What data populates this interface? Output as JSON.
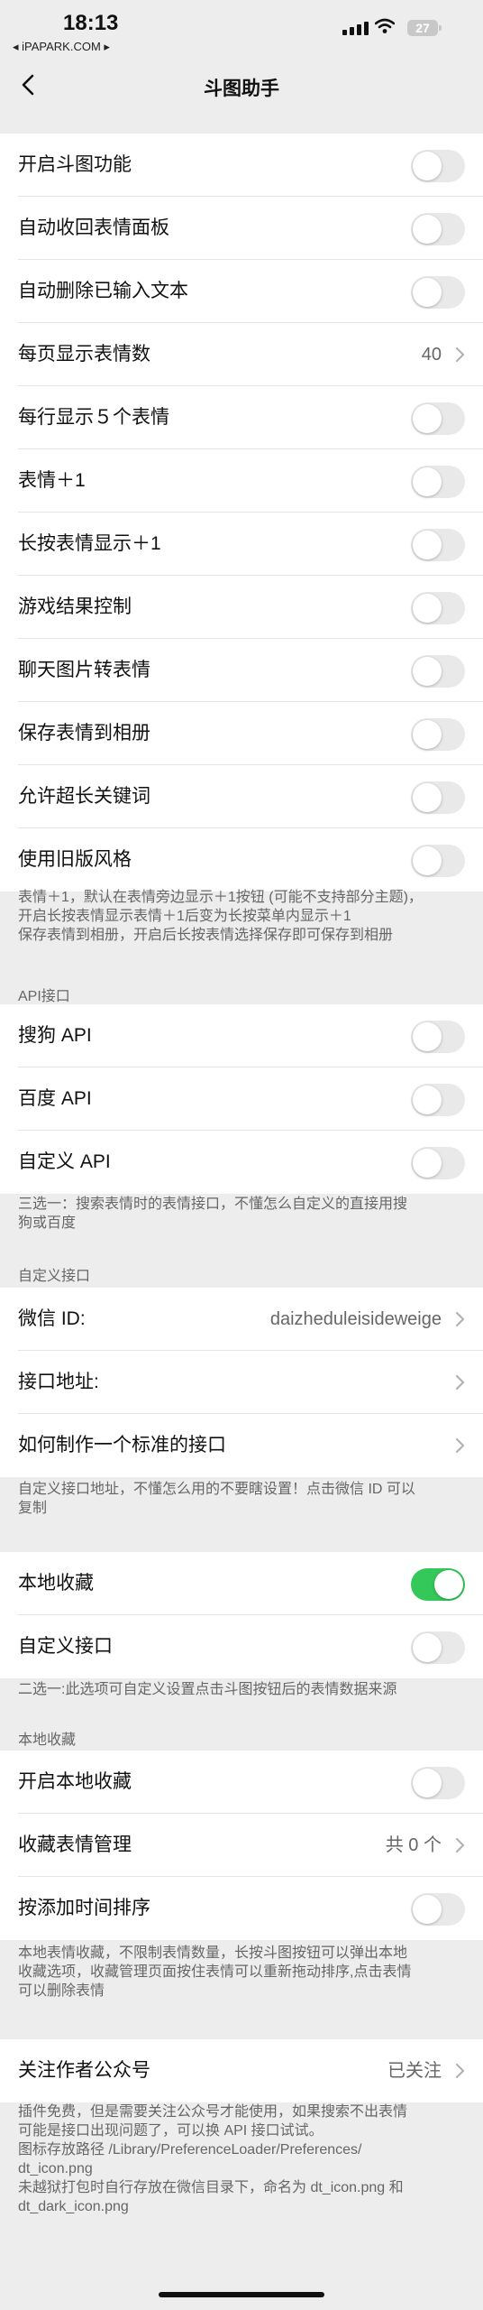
{
  "status": {
    "time": "18:13",
    "carrier": "◂ iPAPARK.COM ▸",
    "battery": "27"
  },
  "nav": {
    "title": "斗图助手"
  },
  "group1": [
    {
      "label": "开启斗图功能",
      "type": "toggle",
      "on": false
    },
    {
      "label": "自动收回表情面板",
      "type": "toggle",
      "on": false
    },
    {
      "label": "自动删除已输入文本",
      "type": "toggle",
      "on": false
    },
    {
      "label": "每页显示表情数",
      "type": "value",
      "value": "40"
    },
    {
      "label": "每行显示５个表情",
      "type": "toggle",
      "on": false
    },
    {
      "label": "表情＋1",
      "type": "toggle",
      "on": false
    },
    {
      "label": "长按表情显示＋1",
      "type": "toggle",
      "on": false
    },
    {
      "label": "游戏结果控制",
      "type": "toggle",
      "on": false
    },
    {
      "label": "聊天图片转表情",
      "type": "toggle",
      "on": false
    },
    {
      "label": "保存表情到相册",
      "type": "toggle",
      "on": false
    },
    {
      "label": "允许超长关键词",
      "type": "toggle",
      "on": false
    },
    {
      "label": "使用旧版风格",
      "type": "toggle",
      "on": false
    }
  ],
  "note1": [
    "表情＋1，默认在表情旁边显示＋1按钮 (可能不支持部分主题)，",
    "开启长按表情显示表情＋1后变为长按菜单内显示＋1",
    "保存表情到相册，开启后长按表情选择保存即可保存到相册"
  ],
  "api_header": "API接口",
  "group2": [
    {
      "label": "搜狗 API",
      "type": "toggle",
      "on": false
    },
    {
      "label": "百度 API",
      "type": "toggle",
      "on": false
    },
    {
      "label": "自定义 API",
      "type": "toggle",
      "on": false
    }
  ],
  "note2": [
    "三选一：搜索表情时的表情接口，不懂怎么自定义的直接用搜",
    "狗或百度"
  ],
  "custom_header": "自定义接口",
  "group3": [
    {
      "label": "微信 ID:",
      "type": "value",
      "value": "daizheduleisideweige"
    },
    {
      "label": "接口地址:",
      "type": "value",
      "value": ""
    },
    {
      "label": "如何制作一个标准的接口",
      "type": "value",
      "value": ""
    }
  ],
  "note3": [
    "自定义接口地址，不懂怎么用的不要瞎设置！点击微信 ID 可以",
    "复制"
  ],
  "group4": [
    {
      "label": "本地收藏",
      "type": "toggle",
      "on": true
    },
    {
      "label": "自定义接口",
      "type": "toggle",
      "on": false
    }
  ],
  "note4": "二选一:此选项可自定义设置点击斗图按钮后的表情数据来源",
  "local_header": "本地收藏",
  "group5": [
    {
      "label": "开启本地收藏",
      "type": "toggle",
      "on": false
    },
    {
      "label": "收藏表情管理",
      "type": "value",
      "value": "共 0 个"
    },
    {
      "label": "按添加时间排序",
      "type": "toggle",
      "on": false
    }
  ],
  "note5": [
    "本地表情收藏，不限制表情数量，长按斗图按钮可以弹出本地",
    "收藏选项，收藏管理页面按住表情可以重新拖动排序,点击表情",
    "可以删除表情"
  ],
  "group6": [
    {
      "label": "关注作者公众号",
      "type": "value",
      "value": "已关注"
    }
  ],
  "note6": [
    "插件免费，但是需要关注公众号才能使用，如果搜索不出表情",
    "可能是接口出现问题了，可以换 API 接口试试。",
    "图标存放路径 /Library/PreferenceLoader/Preferences/",
    "dt_icon.png",
    "未越狱打包时自行存放在微信目录下，命名为 dt_icon.png 和",
    "dt_dark_icon.png"
  ],
  "colors": {
    "toggle_on": "#34c759",
    "toggle_off": "#e9e9ea",
    "background": "#ededed"
  }
}
